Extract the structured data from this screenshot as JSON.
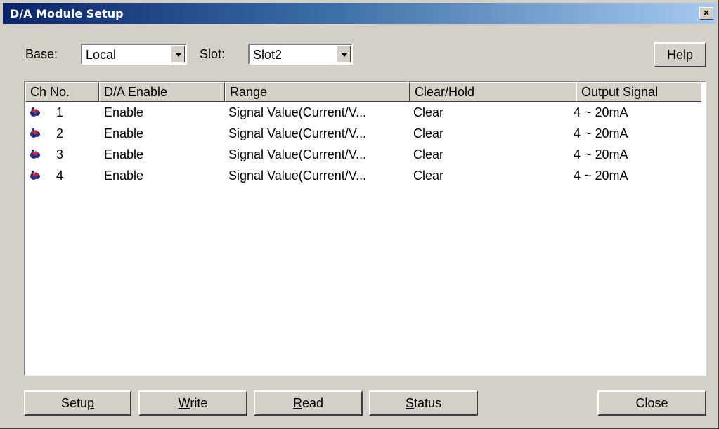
{
  "window": {
    "title": "D/A Module Setup",
    "close_glyph": "×"
  },
  "base": {
    "label": "Base:",
    "value": "Local"
  },
  "slot": {
    "label": "Slot:",
    "value": "Slot2"
  },
  "help_button": "Help",
  "columns": [
    "Ch No.",
    "D/A Enable",
    "Range",
    "Clear/Hold",
    "Output Signal"
  ],
  "rows": [
    {
      "ch": "1",
      "enable": "Enable",
      "range": "Signal Value(Current/V...",
      "clearhold": "Clear",
      "output": "4 ~ 20mA"
    },
    {
      "ch": "2",
      "enable": "Enable",
      "range": "Signal Value(Current/V...",
      "clearhold": "Clear",
      "output": "4 ~ 20mA"
    },
    {
      "ch": "3",
      "enable": "Enable",
      "range": "Signal Value(Current/V...",
      "clearhold": "Clear",
      "output": "4 ~ 20mA"
    },
    {
      "ch": "4",
      "enable": "Enable",
      "range": "Signal Value(Current/V...",
      "clearhold": "Clear",
      "output": "4 ~ 20mA"
    }
  ],
  "row_icon": "channel-icon",
  "buttons": {
    "setup": {
      "pre": "Setu",
      "accel": "p",
      "post": ""
    },
    "write": {
      "pre": "",
      "accel": "W",
      "post": "rite"
    },
    "read": {
      "pre": "",
      "accel": "R",
      "post": "ead"
    },
    "status": {
      "pre": "",
      "accel": "S",
      "post": "tatus"
    },
    "close": "Close"
  },
  "colors": {
    "titlebar_start": "#0a246a",
    "titlebar_end": "#a6caf0",
    "face": "#d4d0c8"
  }
}
